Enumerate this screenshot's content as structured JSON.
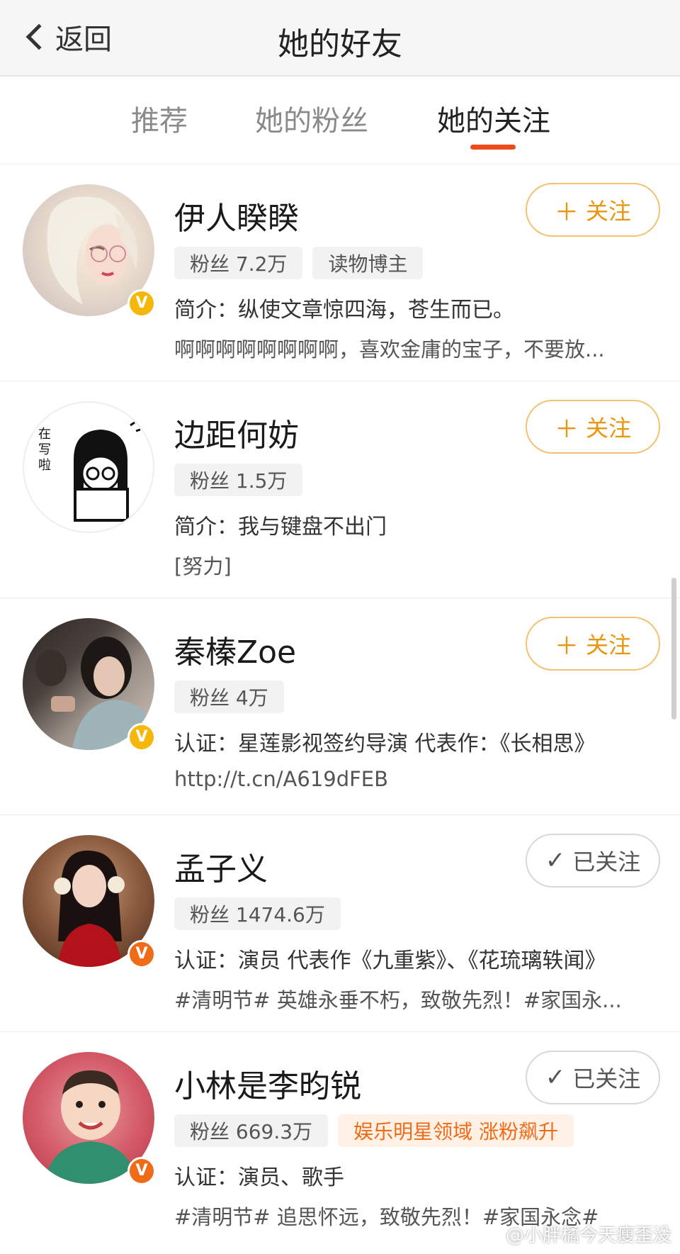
{
  "header": {
    "back_label": "返回",
    "title": "她的好友"
  },
  "tabs": [
    {
      "label": "推荐",
      "active": false
    },
    {
      "label": "她的粉丝",
      "active": false
    },
    {
      "label": "她的关注",
      "active": true
    }
  ],
  "users": [
    {
      "name": "伊人睽睽",
      "badges": [
        "粉丝 7.2万",
        "读物博主"
      ],
      "line1": "简介：纵使文章惊四海，苍生而已。",
      "line2": "啊啊啊啊啊啊啊啊，喜欢金庸的宝子，不要放...",
      "follow_label": "关注",
      "follow_icon": "plus-icon",
      "followed": false,
      "verified": true,
      "verify_color": "#f5b70a",
      "verify_glyph": "V"
    },
    {
      "name": "边距何妨",
      "badges": [
        "粉丝 1.5万"
      ],
      "line1": "简介：我与键盘不出门",
      "line2": "[努力]",
      "follow_label": "关注",
      "follow_icon": "plus-icon",
      "followed": false,
      "verified": false,
      "avatar_text": [
        "在",
        "写",
        "啦"
      ]
    },
    {
      "name": "秦榛Zoe",
      "badges": [
        "粉丝 4万"
      ],
      "line1": "认证：星莲影视签约导演 代表作：《长相思》",
      "line2": "http://t.cn/A619dFEB",
      "follow_label": "关注",
      "follow_icon": "plus-icon",
      "followed": false,
      "verified": true,
      "verify_color": "#f5b70a",
      "verify_glyph": "V"
    },
    {
      "name": "孟子义",
      "badges": [
        "粉丝 1474.6万"
      ],
      "line1": "认证：演员 代表作《九重紫》、《花琉璃轶闻》",
      "line2": "#清明节# 英雄永垂不朽，致敬先烈！#家国永...",
      "follow_label": "已关注",
      "follow_icon": "check-icon",
      "followed": true,
      "verified": true,
      "verify_color": "#ef6b17",
      "verify_glyph": "V"
    },
    {
      "name": "小林是李昀锐",
      "badges": [
        "粉丝 669.3万",
        "娱乐明星领域 涨粉飙升"
      ],
      "line1": "认证：演员、歌手",
      "line2": "#清明节# 追思怀远，致敬先烈！#家国永念#",
      "follow_label": "已关注",
      "follow_icon": "check-icon",
      "followed": true,
      "verified": true,
      "verify_color": "#ef6b17",
      "verify_glyph": "V"
    }
  ],
  "watermark": "@小胖橘今天瘦歪没",
  "colors": {
    "accent": "#ee4a1e",
    "follow": "#e8960e",
    "hot_badge": "#ef6b17"
  }
}
